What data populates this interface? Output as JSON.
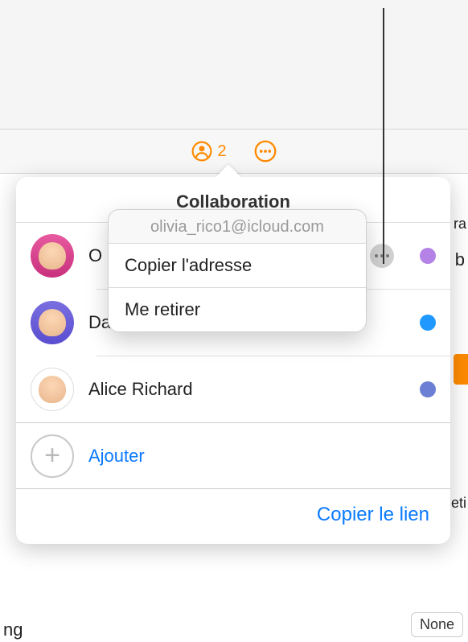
{
  "toolbar": {
    "collaboration_count": "2"
  },
  "popover": {
    "title": "Collaboration",
    "participants": [
      {
        "name": "Olivia Rico",
        "display": "O",
        "presence": "purple",
        "shows_more": true
      },
      {
        "name": "Daniel Richard (propriétaire)",
        "presence": "blue"
      },
      {
        "name": "Alice Richard",
        "presence": "slate"
      }
    ],
    "add_label": "Ajouter",
    "copy_link_label": "Copier le lien"
  },
  "context_menu": {
    "header": "olivia_rico1@icloud.com",
    "copy_address_label": "Copier l'adresse",
    "remove_me_label": "Me retirer"
  },
  "background": {
    "stub_letter_b": "b",
    "stub_suffix_ra": "ra",
    "stub_suffix_eti": "eti",
    "stub_suffix_ng": "ng",
    "none_label": "None"
  }
}
